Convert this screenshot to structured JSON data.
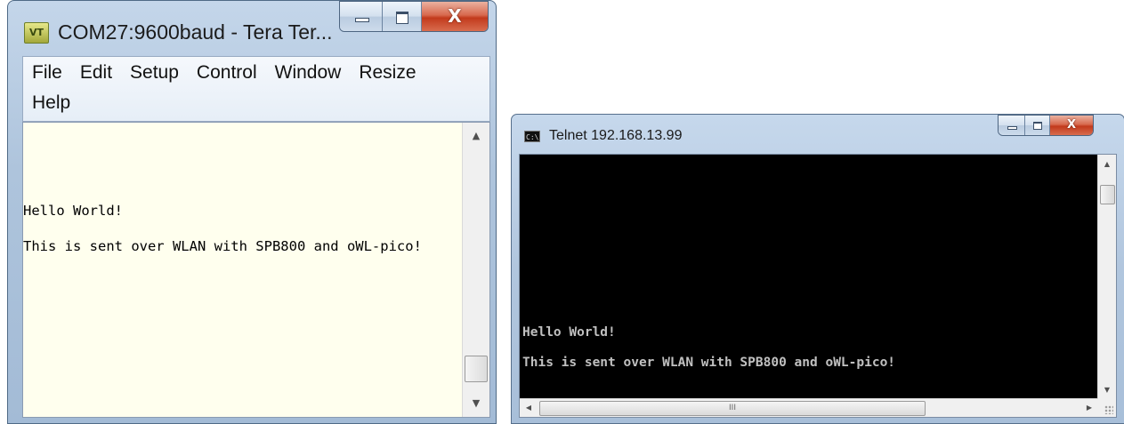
{
  "teraterm": {
    "title": "COM27:9600baud - Tera Ter...",
    "app_icon": "VT",
    "controls": {
      "minimize_icon": "minimize-icon",
      "maximize_icon": "maximize-icon",
      "close_glyph": "X"
    },
    "menu": {
      "row1": [
        "File",
        "Edit",
        "Setup",
        "Control",
        "Window",
        "Resize"
      ],
      "row2": [
        "Help"
      ]
    },
    "terminal_lines": [
      "Hello World!",
      "This is sent over WLAN with SPB800 and oWL-pico!"
    ],
    "background_color": "#ffffee",
    "text_color": "#000000",
    "scroll_up": "▲",
    "scroll_down": "▼"
  },
  "telnet": {
    "title": "Telnet 192.168.13.99",
    "app_icon": "C:\\",
    "controls": {
      "minimize_icon": "minimize-icon",
      "maximize_icon": "maximize-icon",
      "close_glyph": "X"
    },
    "terminal_lines": [
      "Hello World!",
      "This is sent over WLAN with SPB800 and oWL-pico!"
    ],
    "background_color": "#000000",
    "text_color": "#c0c0c0",
    "scroll_up": "▲",
    "scroll_down": "▼",
    "scroll_left": "◀",
    "scroll_right": "▶",
    "hscroll_thumb_grip": "III"
  }
}
